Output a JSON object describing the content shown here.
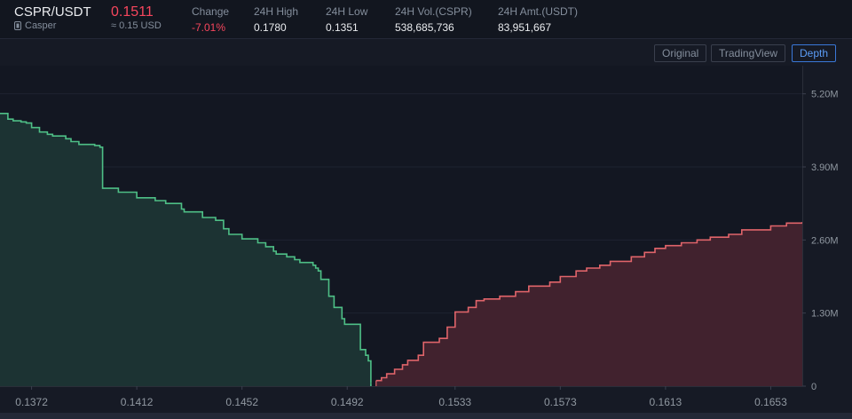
{
  "header": {
    "pair": "CSPR/USDT",
    "coin_name": "Casper",
    "coin_icon": "casper-coin-icon",
    "last_price": "0.1511",
    "price_usd": "≈ 0.15 USD",
    "stats": [
      {
        "label": "Change",
        "value": "-7.01%",
        "negative": true
      },
      {
        "label": "24H High",
        "value": "0.1780",
        "negative": false
      },
      {
        "label": "24H Low",
        "value": "0.1351",
        "negative": false
      },
      {
        "label": "24H Vol.(CSPR)",
        "value": "538,685,736",
        "negative": false
      },
      {
        "label": "24H Amt.(USDT)",
        "value": "83,951,667",
        "negative": false
      }
    ]
  },
  "toolbar": {
    "original": "Original",
    "tradingview": "TradingView",
    "depth": "Depth",
    "active": "depth"
  },
  "chart_data": {
    "type": "area",
    "title": "",
    "xlabel": "",
    "ylabel": "",
    "xlim": [
      0.136,
      0.1665
    ],
    "ylim": [
      0,
      5.7
    ],
    "x_ticks": [
      "0.1372",
      "0.1412",
      "0.1452",
      "0.1492",
      "0.1533",
      "0.1573",
      "0.1613",
      "0.1653"
    ],
    "x_tick_values": [
      0.1372,
      0.1412,
      0.1452,
      0.1492,
      0.1533,
      0.1573,
      0.1613,
      0.1653
    ],
    "y_ticks": [
      "0",
      "1.30M",
      "2.60M",
      "3.90M",
      "5.20M"
    ],
    "y_tick_values": [
      0,
      1.3,
      2.6,
      3.9,
      5.2
    ],
    "colors": {
      "bids_line": "#4ebf86",
      "bids_fill": "#1c3333",
      "asks_line": "#e0646a",
      "asks_fill": "#41222e"
    },
    "series": [
      {
        "side": "bids",
        "x": [
          0.136,
          0.1363,
          0.1365,
          0.1368,
          0.137,
          0.1372,
          0.1375,
          0.1378,
          0.138,
          0.1385,
          0.1387,
          0.139,
          0.1396,
          0.1398,
          0.1399,
          0.1405,
          0.1412,
          0.1419,
          0.1423,
          0.1429,
          0.143,
          0.1437,
          0.1442,
          0.1445,
          0.1447,
          0.1452,
          0.1458,
          0.1461,
          0.1464,
          0.1465,
          0.1469,
          0.1472,
          0.1474,
          0.1479,
          0.148,
          0.1481,
          0.1482,
          0.1485,
          0.1485,
          0.1487,
          0.149,
          0.1491,
          0.1497,
          0.1499,
          0.15,
          0.1501
        ],
        "y": [
          4.85,
          4.75,
          4.72,
          4.7,
          4.68,
          4.6,
          4.52,
          4.48,
          4.45,
          4.4,
          4.35,
          4.3,
          4.28,
          4.25,
          3.52,
          3.45,
          3.35,
          3.3,
          3.25,
          3.15,
          3.1,
          3.0,
          2.95,
          2.8,
          2.7,
          2.62,
          2.55,
          2.48,
          2.4,
          2.35,
          2.3,
          2.25,
          2.2,
          2.15,
          2.1,
          2.05,
          1.9,
          1.75,
          1.6,
          1.4,
          1.2,
          1.1,
          0.65,
          0.55,
          0.45,
          0.05
        ]
      },
      {
        "side": "asks",
        "x": [
          0.1503,
          0.1505,
          0.1507,
          0.151,
          0.1513,
          0.1515,
          0.1519,
          0.1521,
          0.1527,
          0.153,
          0.1533,
          0.1538,
          0.1541,
          0.1544,
          0.155,
          0.1556,
          0.1561,
          0.1569,
          0.1573,
          0.1579,
          0.1583,
          0.1588,
          0.1592,
          0.16,
          0.1605,
          0.1609,
          0.1613,
          0.1619,
          0.1625,
          0.163,
          0.1637,
          0.1642,
          0.1653,
          0.1659,
          0.1665
        ],
        "y": [
          0.1,
          0.15,
          0.22,
          0.3,
          0.38,
          0.46,
          0.55,
          0.78,
          0.85,
          1.05,
          1.32,
          1.4,
          1.52,
          1.55,
          1.6,
          1.68,
          1.78,
          1.85,
          1.95,
          2.05,
          2.1,
          2.15,
          2.22,
          2.3,
          2.38,
          2.45,
          2.5,
          2.55,
          2.6,
          2.65,
          2.7,
          2.78,
          2.85,
          2.9,
          2.92
        ]
      }
    ]
  }
}
